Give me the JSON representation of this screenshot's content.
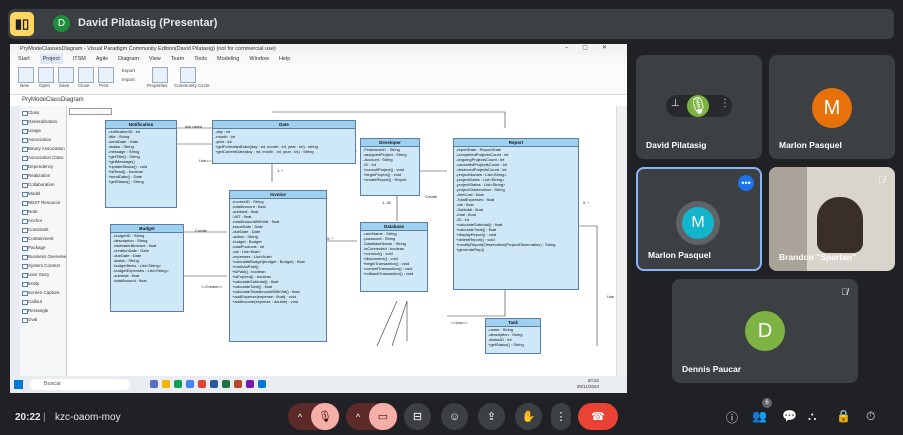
{
  "top_bar": {
    "presenter_initial": "D",
    "presenter_label": "David Pilatasig (Presentar)"
  },
  "shared_screen": {
    "window_title": "PryModeClassesDiagram - Visual Paradigm Community Edition(David Pilatasig) (not for commercial use)",
    "menu": [
      "Start",
      "Project",
      "ITSM",
      "Agile",
      "Diagram",
      "View",
      "Team",
      "Tools",
      "Modeling",
      "Window",
      "Help"
    ],
    "ribbon": [
      "New",
      "Open",
      "Save",
      "Close",
      "Print",
      "Export",
      "Import",
      "Properties",
      "Community Circle"
    ],
    "diagram_title": "PryModeClassDiagram",
    "package_tab": "<<No Package>>",
    "palette": [
      "Class",
      "Generalization",
      "Usage",
      "Association",
      "Binary Association",
      "Association Class",
      "Dependency",
      "Realization",
      "Collaboration",
      "Model",
      "REST Resource",
      "Note",
      "Anchor",
      "Constraint",
      "Containment",
      "Package",
      "Business Overview",
      "System Context",
      "User Story",
      "Entity",
      "Screen Capture",
      "Callout",
      "Rectangle",
      "Oval"
    ],
    "taskbar_search": "Buscar",
    "taskbar_time": "20:22",
    "taskbar_date": "25/11/2024",
    "classes": [
      {
        "name": "Notification",
        "rows": [
          "-notificationID : int",
          "-title : String",
          "-sendDate : Date",
          "-status : String",
          "-message : String",
          "+getTitle() : String",
          "+getMessage()",
          "+updateStatus() : void",
          "+isRead() : boolean",
          "+sendDate() : Date",
          "+getStatus() : String"
        ]
      },
      {
        "name": "Date",
        "rows": [
          "-day : int",
          "-month : int",
          "-year : int",
          "+getFormattedDate(day : int, month : int, year : int) : string",
          "+getCurrentDate(day : int, month : int, year : int) : String"
        ]
      },
      {
        "name": "Developer",
        "rows": [
          "-FirstnameID : String",
          "-assignedProject : String",
          "-Account : String",
          "-ID : int",
          "+consultProject() : void",
          "+beginProject() : void",
          "+createReport() : Report"
        ]
      },
      {
        "name": "Report",
        "rows": [
          "-reportDate : Report/Date",
          "-completedProjectsCount : int",
          "-ongoingProjectsCount : int",
          "-cancelledProjectsCount : int",
          "-observedProjectsCount : int",
          "-projectNames : List<String>",
          "-projectDates : List<String>",
          "-projectStates : List<String>",
          "-projectObservation : String",
          "-AmtCost : float",
          "-TotalExpenses : float",
          "-vat : float",
          "-Subtotal : float",
          "-total : float",
          "-ID : int",
          "+calculateSubtotal() : float",
          "+calculateTotal() : float",
          "+displayReport() : void",
          "+deleteReport() : void",
          "+modifyReport(Observation(ProjectObservation) : String",
          "+generateRep()"
        ]
      },
      {
        "name": "Invoice",
        "rows": [
          "-invoiceID : String",
          "-totalAmount : float",
          "-subtotal : float",
          "-VAT : float",
          "-totalAmountWithVat : float",
          "-issueDate : Date",
          "-dueDate : Date",
          "-status : String",
          "-budget : Budget",
          "-totalProducts : int",
          "-vat : List<float>",
          "-expenses : List<float>",
          "+calculateBudget(budget : Budget) : float",
          "+markAsPaid()",
          "+isPaid() : boolean",
          "+isExpired() : boolean",
          "+calculateSubtotal() : float",
          "+calculateTotal() : float",
          "+calculateTotalAmountWithVat() : float",
          "+addExpense(expense : float) : void",
          "+addIncome(expense : double) : void"
        ]
      },
      {
        "name": "Budget",
        "rows": [
          "-budgetID : String",
          "-description : String",
          "-estimatedAmount : float",
          "-creationDate : Date",
          "-dueDate : Date",
          "-status : String",
          "-budgetItems : List<String>",
          "-budgetExpenses : List<String>",
          "-subtotal : float",
          "-totalAmount : float"
        ]
      },
      {
        "name": "Database",
        "rows": [
          "-userName : String",
          "-password : String",
          "-DatabaseName : String",
          "-isConnected : boolean",
          "+connect() : void",
          "+disconnect() : void",
          "+beginTransaction() : void",
          "+commitTransaction() : void",
          "+rollbackTransaction() : void"
        ]
      },
      {
        "name": "Task",
        "rows": [
          "-name : String",
          "-description : String",
          "-statusID : int",
          "+getStatus() : String"
        ]
      }
    ],
    "relation_labels": [
      "Are usted",
      "Use>>",
      "Create",
      "Create",
      "<<Create>>",
      "<<Use>>",
      "Use",
      "1..*",
      "0..*",
      "1..30",
      "0..*"
    ]
  },
  "participants": [
    {
      "initial": "",
      "name": "David Pilatasig",
      "muted": false,
      "color": "#3c4043"
    },
    {
      "initial": "M",
      "name": "Marlon Pasquel",
      "muted": false,
      "color": "#e8710a"
    },
    {
      "initial": "M",
      "name": "Marlon Pasquel",
      "muted": false,
      "color": "#12b5cb"
    },
    {
      "initial": "",
      "name": "Brandon \"Spartan\"",
      "muted": true,
      "color": "#3c4043"
    },
    {
      "initial": "D",
      "name": "Dennis Paucar",
      "muted": true,
      "color": "#7cb342"
    }
  ],
  "bottom_bar": {
    "time": "20:22",
    "separator": "|",
    "meeting_code": "kzc-oaom-moy",
    "people_count": "6"
  },
  "colors": {
    "meet_bg": "#202124",
    "tile_bg": "#3c4043",
    "end_call": "#ea4335",
    "muted_pill": "#f6aea9",
    "active_border": "#8ab4f8"
  }
}
